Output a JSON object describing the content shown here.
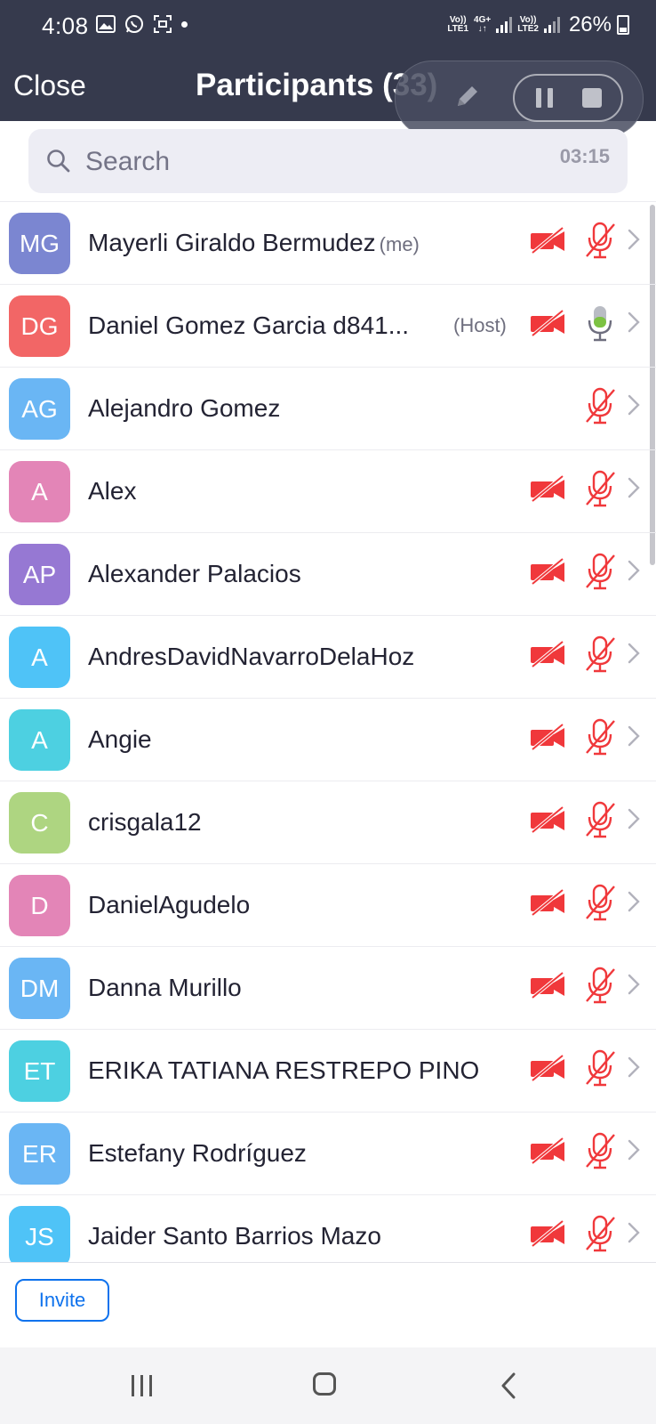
{
  "status_bar": {
    "time": "4:08",
    "network1_top": "Vo))",
    "network1_bottom": "LTE1",
    "network_type": "4G+",
    "network2_top": "Vo))",
    "network2_bottom": "LTE2",
    "battery": "26%"
  },
  "header": {
    "close_label": "Close",
    "title": "Participants (33)"
  },
  "search": {
    "placeholder": "Search",
    "timer": "03:15"
  },
  "participants": [
    {
      "initials": "MG",
      "name": "Mayerli Giraldo Bermudez",
      "tag": "(me)",
      "color": "#7b86d1",
      "video": "off",
      "mic": "muted"
    },
    {
      "initials": "DG",
      "name": "Daniel Gomez Garcia d841...",
      "tag": "(Host)",
      "color": "#f26666",
      "video": "off",
      "mic": "on"
    },
    {
      "initials": "AG",
      "name": "Alejandro Gomez",
      "tag": "",
      "color": "#6ab6f4",
      "video": "none",
      "mic": "muted"
    },
    {
      "initials": "A",
      "name": "Alex",
      "tag": "",
      "color": "#e385b7",
      "video": "off",
      "mic": "muted"
    },
    {
      "initials": "AP",
      "name": "Alexander Palacios",
      "tag": "",
      "color": "#9678d3",
      "video": "off",
      "mic": "muted"
    },
    {
      "initials": "A",
      "name": "AndresDavidNavarroDelaHoz",
      "tag": "",
      "color": "#4fc3f7",
      "video": "off",
      "mic": "muted"
    },
    {
      "initials": "A",
      "name": "Angie",
      "tag": "",
      "color": "#4dd0e1",
      "video": "off",
      "mic": "muted"
    },
    {
      "initials": "C",
      "name": "crisgala12",
      "tag": "",
      "color": "#aed581",
      "video": "off",
      "mic": "muted"
    },
    {
      "initials": "D",
      "name": "DanielAgudelo",
      "tag": "",
      "color": "#e385b7",
      "video": "off",
      "mic": "muted"
    },
    {
      "initials": "DM",
      "name": "Danna Murillo",
      "tag": "",
      "color": "#6ab6f4",
      "video": "off",
      "mic": "muted"
    },
    {
      "initials": "ET",
      "name": "ERIKA TATIANA RESTREPO PINO",
      "tag": "",
      "color": "#4dd0e1",
      "video": "off",
      "mic": "muted"
    },
    {
      "initials": "ER",
      "name": "Estefany Rodríguez",
      "tag": "",
      "color": "#6ab6f4",
      "video": "off",
      "mic": "muted"
    },
    {
      "initials": "JS",
      "name": "Jaider Santo Barrios Mazo",
      "tag": "",
      "color": "#4fc3f7",
      "video": "off",
      "mic": "muted"
    }
  ],
  "footer": {
    "invite_label": "Invite"
  },
  "colors": {
    "header_bg": "#363a4d",
    "muted_red": "#f0383b",
    "mic_on_green": "#8bc34a",
    "invite_blue": "#0e72ed"
  }
}
